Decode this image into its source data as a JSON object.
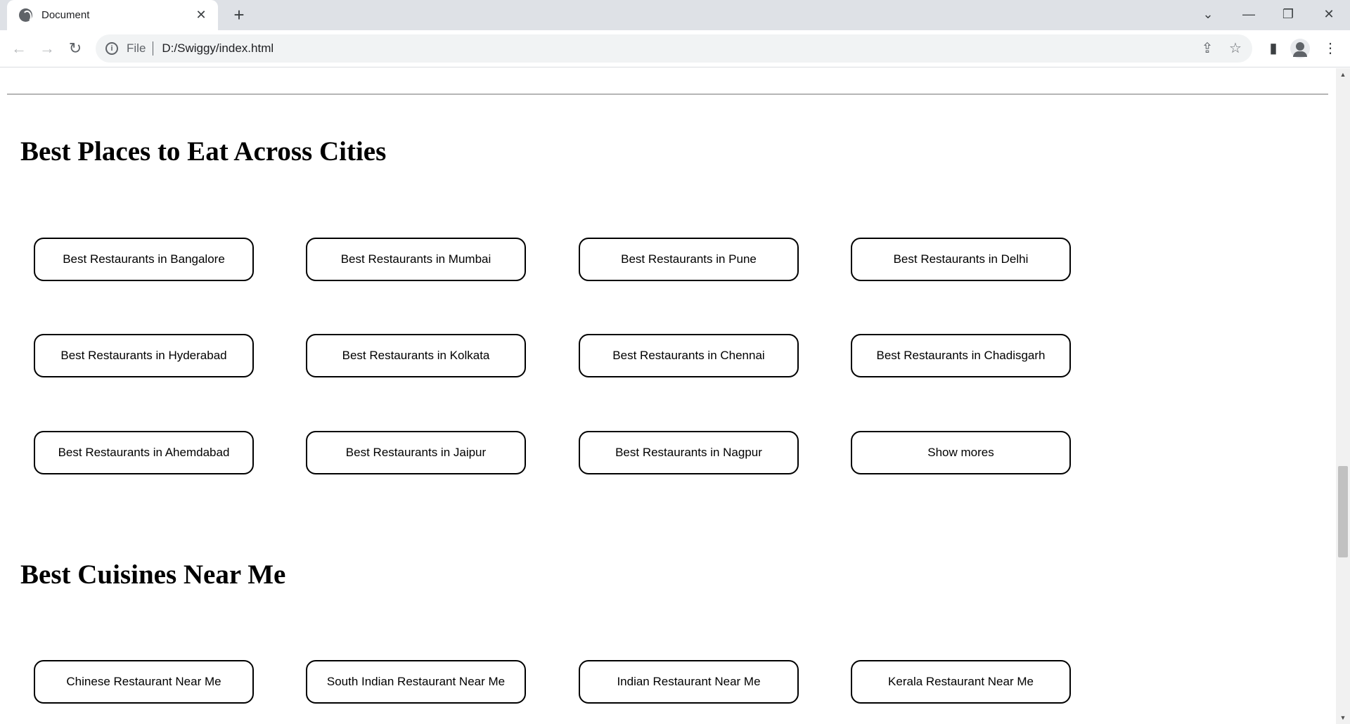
{
  "browser": {
    "tab_title": "Document",
    "new_tab_label": "+",
    "close_tab_label": "✕",
    "url_scheme": "File",
    "url": "D:/Swiggy/index.html"
  },
  "sections": {
    "cities": {
      "title": "Best Places to Eat Across Cities",
      "items": [
        "Best Restaurants in Bangalore",
        "Best Restaurants in Mumbai",
        "Best Restaurants in Pune",
        "Best Restaurants in Delhi",
        "Best Restaurants in Hyderabad",
        "Best Restaurants in Kolkata",
        "Best Restaurants in Chennai",
        "Best Restaurants in Chadisgarh",
        "Best Restaurants in Ahemdabad",
        "Best Restaurants in Jaipur",
        "Best Restaurants in Nagpur",
        "Show mores"
      ]
    },
    "cuisines": {
      "title": "Best Cuisines Near Me",
      "items": [
        "Chinese Restaurant Near Me",
        "South Indian Restaurant Near Me",
        "Indian Restaurant Near Me",
        "Kerala Restaurant Near Me"
      ]
    }
  }
}
